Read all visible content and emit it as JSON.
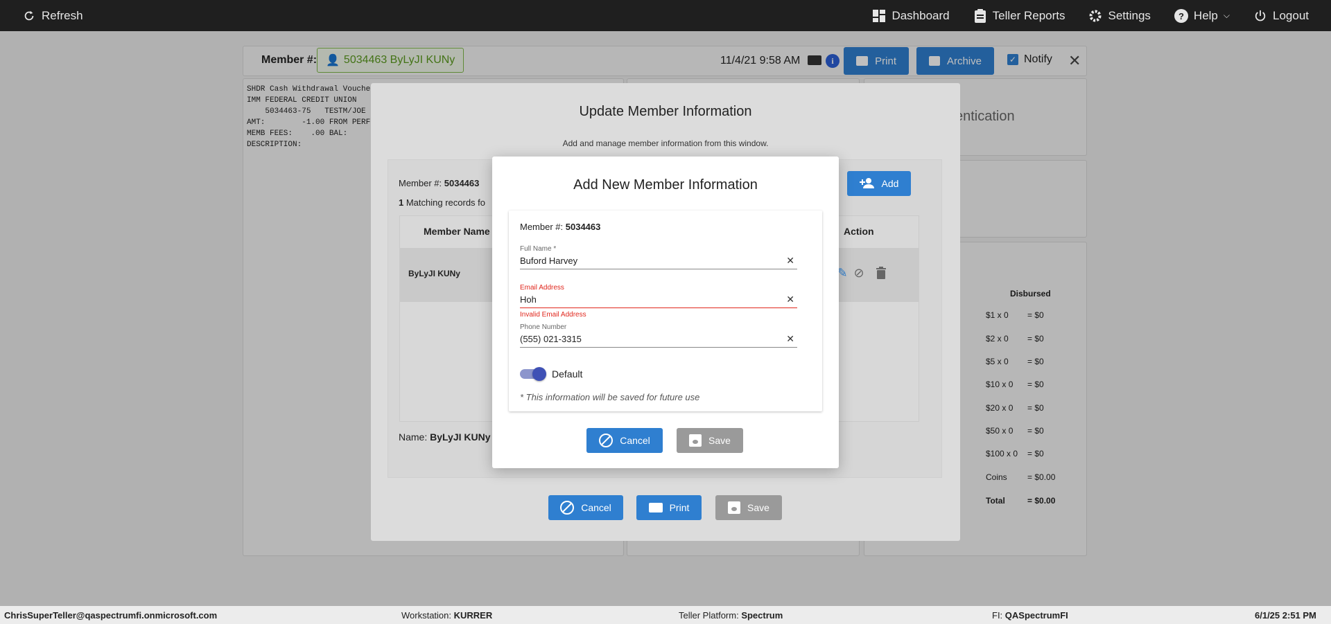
{
  "topbar": {
    "refresh": "Refresh",
    "dashboard": "Dashboard",
    "teller_reports": "Teller Reports",
    "settings": "Settings",
    "help": "Help",
    "logout": "Logout"
  },
  "header": {
    "member_label": "Member #:",
    "member_badge": "5034463 ByLyJI KUNy",
    "datetime": "11/4/21 9:58 AM",
    "print": "Print",
    "archive": "Archive",
    "notify": "Notify"
  },
  "voucher_text": "SHDR Cash Withdrawal Vouche\nIMM FEDERAL CREDIT UNION\n    5034463-75   TESTM/JOE\nAMT:        -1.00 FROM PERF\nMEMB FEES:    .00 BAL:\nDESCRIPTION:",
  "auth_text": "entication",
  "disbursed": {
    "header": "Disbursed",
    "rows": [
      {
        "denom": "$1 x 0",
        "amt": "= $0"
      },
      {
        "denom": "$2 x 0",
        "amt": "= $0"
      },
      {
        "denom": "$5 x 0",
        "amt": "= $0"
      },
      {
        "denom": "$10 x 0",
        "amt": "= $0"
      },
      {
        "denom": "$20 x 0",
        "amt": "= $0"
      },
      {
        "denom": "$50 x 0",
        "amt": "= $0"
      },
      {
        "denom": "$100 x 0",
        "amt": "= $0"
      },
      {
        "denom": "Coins",
        "amt": "= $0.00"
      },
      {
        "denom": "Total",
        "amt": "= $0.00"
      }
    ]
  },
  "update_modal": {
    "title": "Update Member Information",
    "subtitle": "Add and manage member information from this window.",
    "member_label": "Member #: ",
    "member_number": "5034463",
    "match_count": "1",
    "match_text": " Matching records fo",
    "add": "Add",
    "col_member_name": "Member Name",
    "col_action": "Action",
    "row_name": "ByLyJI KUNy",
    "name_label": "Name: ",
    "name_value": "ByLyJI KUNy",
    "cancel": "Cancel",
    "print": "Print",
    "save": "Save"
  },
  "add_modal": {
    "title": "Add New Member Information",
    "member_label": "Member #: ",
    "member_number": "5034463",
    "full_name_label": "Full Name *",
    "full_name_value": "Buford Harvey",
    "email_label": "Email Address",
    "email_value": "Hoh",
    "email_error": "Invalid Email Address",
    "phone_label": "Phone Number",
    "phone_value": "(555) 021-3315",
    "default_label": "Default",
    "default_on": true,
    "note": "* This information will be saved for future use",
    "cancel": "Cancel",
    "save": "Save"
  },
  "footer": {
    "user": "ChrisSuperTeller@qaspectrumfi.onmicrosoft.com",
    "workstation_label": "Workstation: ",
    "workstation": "KURRER",
    "platform_label": "Teller Platform: ",
    "platform": "Spectrum",
    "fi_label": "FI: ",
    "fi": "QASpectrumFI",
    "datetime": "6/1/25 2:51 PM"
  },
  "colors": {
    "primary": "#2f7fd0",
    "error": "#e0261c",
    "toggle": "#3f51b5",
    "topbar": "#1f1f1f",
    "disabled": "#9a9a9a"
  }
}
